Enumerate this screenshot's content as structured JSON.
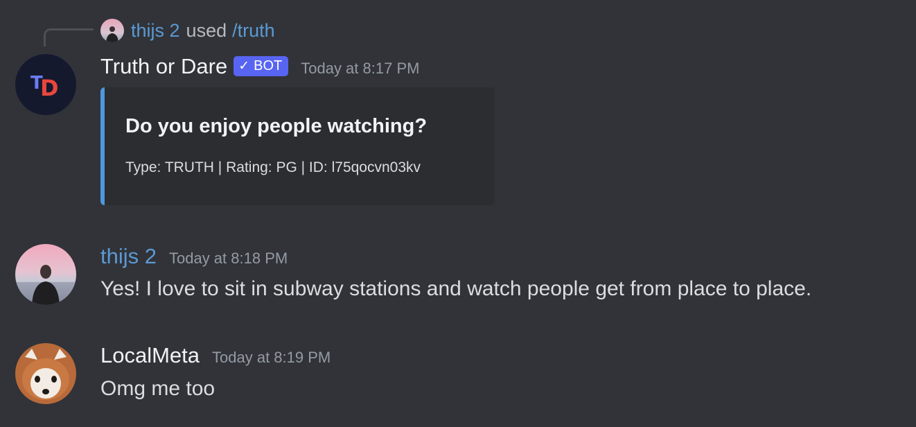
{
  "reply": {
    "user": "thijs 2",
    "used": "used",
    "command": "/truth"
  },
  "messages": [
    {
      "author": "Truth or Dare",
      "bot_badge": "BOT",
      "timestamp": "Today at 8:17 PM",
      "embed": {
        "title": "Do you enjoy people watching?",
        "footer": "Type: TRUTH | Rating: PG | ID: l75qocvn03kv",
        "accent_color": "#4f97dd"
      }
    },
    {
      "author": "thijs 2",
      "timestamp": "Today at 8:18 PM",
      "text": "Yes! I love to sit in subway stations and watch people get from place to place."
    },
    {
      "author": "LocalMeta",
      "timestamp": "Today at 8:19 PM",
      "text": "Omg me too"
    }
  ],
  "colors": {
    "background": "#313338",
    "embed_background": "#2b2d31",
    "link_blue": "#5b9ad4",
    "bot_badge": "#5865f2",
    "timestamp": "#949ba4"
  },
  "icons": {
    "bot_avatar": "truth-or-dare-td-logo",
    "bot_badge_check": "verified-check-icon"
  }
}
